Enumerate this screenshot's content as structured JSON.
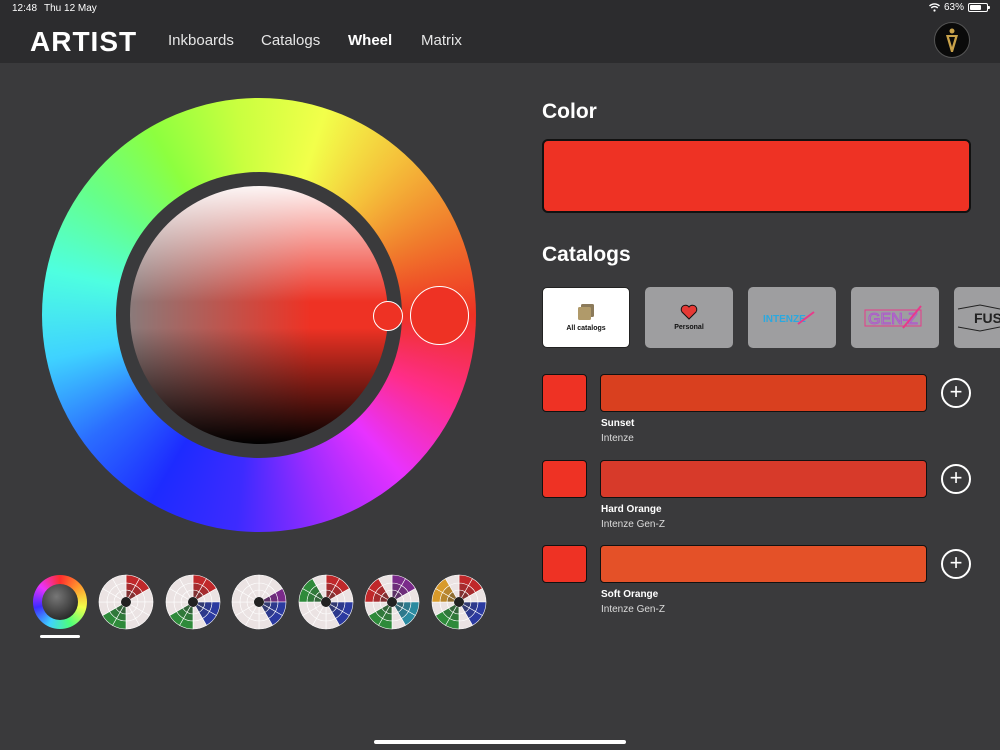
{
  "status": {
    "time": "12:48",
    "date": "Thu 12 May",
    "battery": "63%"
  },
  "nav": {
    "brand": "ARTIST",
    "items": [
      {
        "label": "Inkboards",
        "active": false
      },
      {
        "label": "Catalogs",
        "active": false
      },
      {
        "label": "Wheel",
        "active": true
      },
      {
        "label": "Matrix",
        "active": false
      }
    ],
    "logo_icon": "brand-logo-icon"
  },
  "color_section": {
    "title": "Color",
    "selected_color": "#ee3224"
  },
  "catalogs_section": {
    "title": "Catalogs",
    "cards": [
      {
        "label": "All catalogs",
        "icon": "stack-icon",
        "selected": true
      },
      {
        "label": "Personal",
        "icon": "heart-icon",
        "selected": false
      },
      {
        "label": "INTENZE",
        "icon": "intenze-logo",
        "selected": false
      },
      {
        "label": "GEN-Z",
        "icon": "genz-logo",
        "selected": false
      },
      {
        "label": "FUS",
        "icon": "fusion-logo",
        "selected": false
      }
    ]
  },
  "swatches": [
    {
      "name": "Sunset",
      "brand": "Intenze",
      "color": "#d9401f"
    },
    {
      "name": "Hard Orange",
      "brand": "Intenze Gen-Z",
      "color": "#d73a2a"
    },
    {
      "name": "Soft Orange",
      "brand": "Intenze Gen-Z",
      "color": "#e45128"
    }
  ],
  "harmony_schemes": [
    "full-wheel",
    "complementary",
    "split-complementary",
    "triadic",
    "analogous",
    "tetradic",
    "square"
  ]
}
